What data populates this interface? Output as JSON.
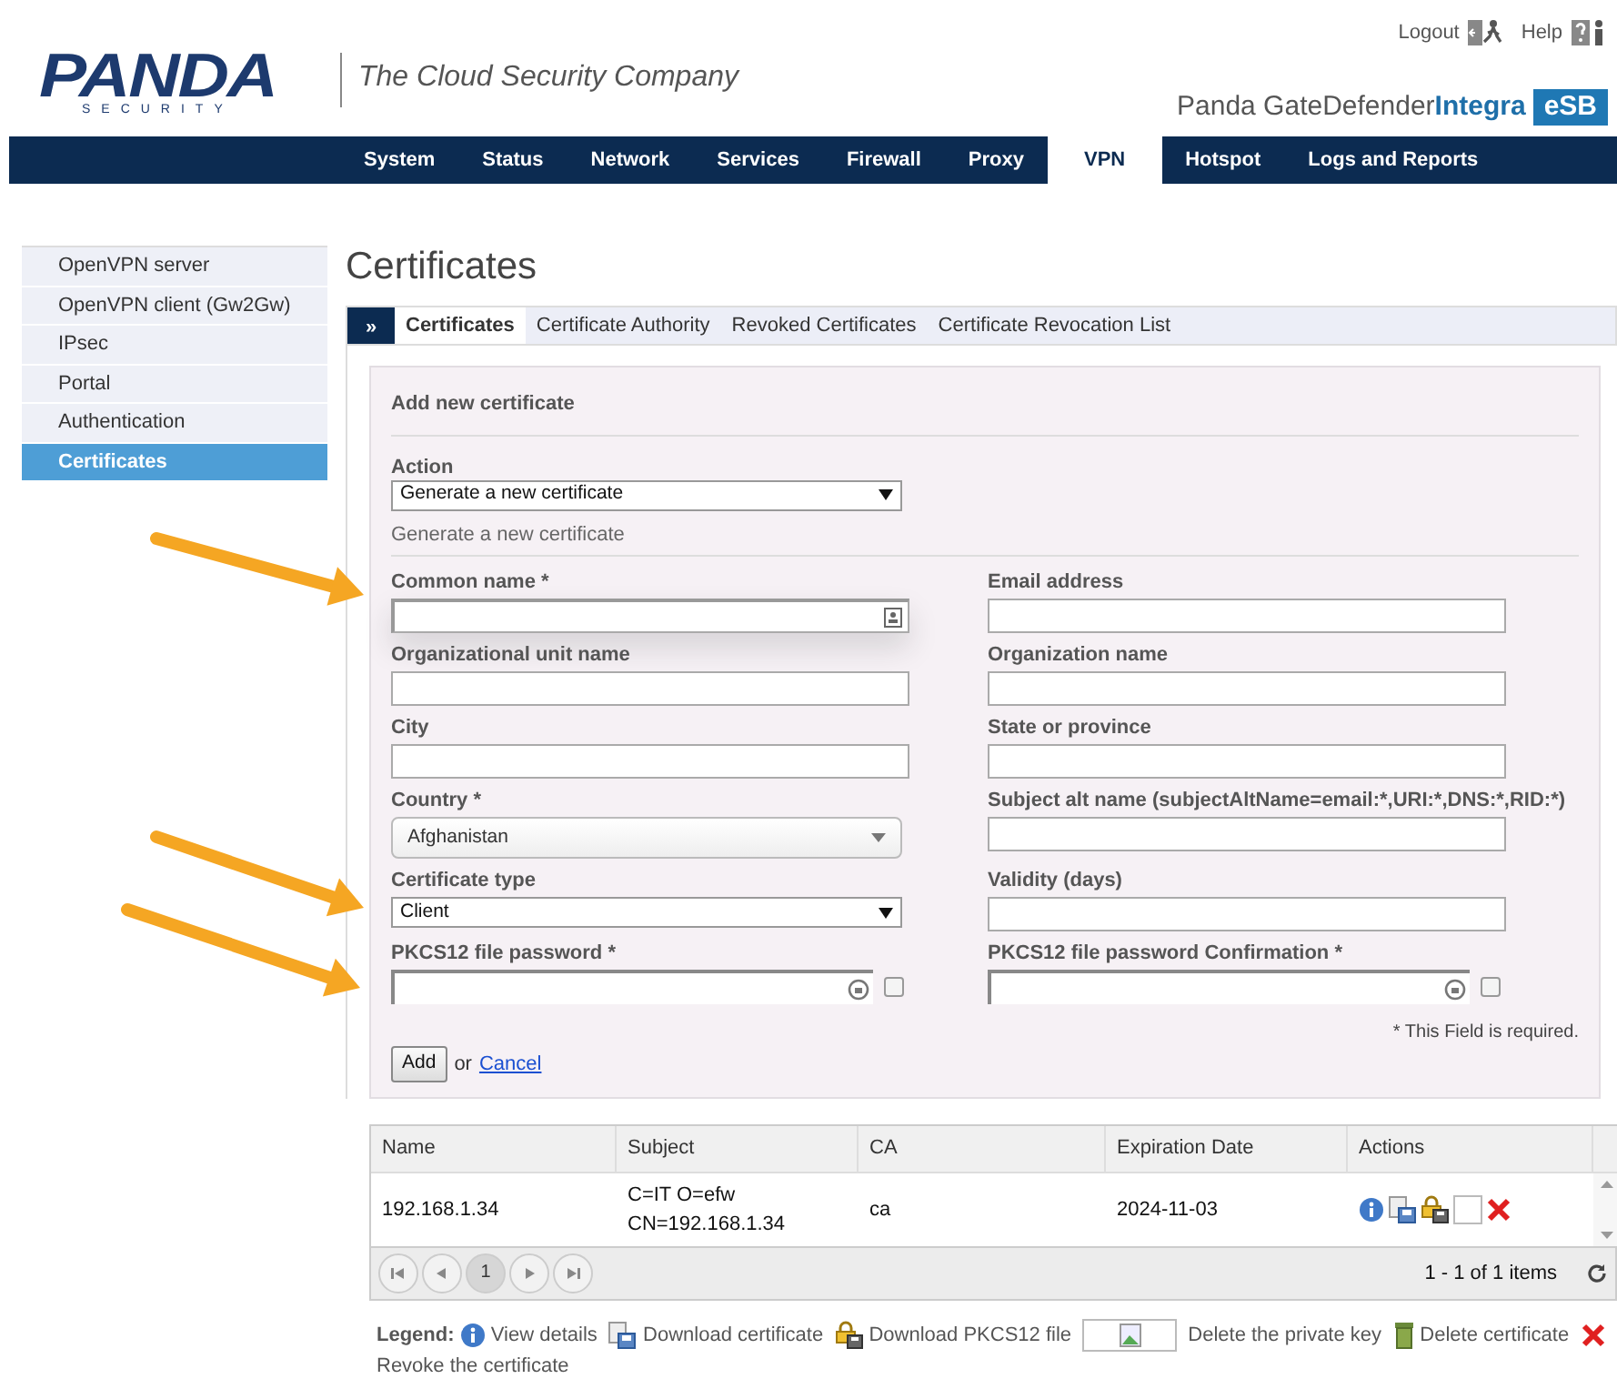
{
  "header": {
    "logo_name": "PANDA",
    "logo_sub": "SECURITY",
    "tagline": "The Cloud Security Company",
    "links": [
      {
        "label": "Logout",
        "kind": "logout"
      },
      {
        "label": "Help",
        "kind": "help"
      }
    ],
    "product": "Panda GateDefender**Integra**",
    "product_badge": "eSB"
  },
  "nav": [
    {
      "label": "System",
      "selected": false
    },
    {
      "label": "Status",
      "selected": false
    },
    {
      "label": "Network",
      "selected": false
    },
    {
      "label": "Services",
      "selected": false
    },
    {
      "label": "Firewall",
      "selected": false
    },
    {
      "label": "Proxy",
      "selected": false
    },
    {
      "label": "VPN",
      "selected": true
    },
    {
      "label": "Hotspot",
      "selected": false
    },
    {
      "label": "Logs and Reports",
      "selected": false
    }
  ],
  "sidebar": [
    {
      "label": "OpenVPN server",
      "selected": false
    },
    {
      "label": "OpenVPN client (Gw2Gw)",
      "selected": false
    },
    {
      "label": "IPsec",
      "selected": false
    },
    {
      "label": "Portal",
      "selected": false
    },
    {
      "label": "Authentication",
      "selected": false
    },
    {
      "label": "Certificates",
      "selected": true
    }
  ],
  "page_title": "Certificates",
  "tab_toggle": "»",
  "tabs": [
    {
      "label": "Certificates",
      "selected": true
    },
    {
      "label": "Certificate Authority",
      "selected": false
    },
    {
      "label": "Revoked Certificates",
      "selected": false
    },
    {
      "label": "Certificate Revocation List",
      "selected": false
    }
  ],
  "form": {
    "title": "Add new certificate",
    "action": {
      "label": "Action",
      "value": "Generate a new certificate"
    },
    "subtitle": "Generate a new certificate",
    "fields": [
      {
        "label": "Common name *",
        "kind": "text-icon"
      },
      {
        "label": "Email address",
        "kind": "text"
      },
      {
        "label": "Organizational unit name",
        "kind": "text"
      },
      {
        "label": "Organization name",
        "kind": "text"
      },
      {
        "label": "City",
        "kind": "text"
      },
      {
        "label": "State or province",
        "kind": "text"
      },
      {
        "label": "Country *",
        "kind": "select-rounded",
        "value": "Afghanistan"
      },
      {
        "label": "Subject alt name (subjectAltName=email:*,URI:*,DNS:*,RID:*)",
        "kind": "text"
      },
      {
        "label": "Certificate type",
        "kind": "select",
        "value": "Client"
      },
      {
        "label": "Validity (days)",
        "kind": "text"
      },
      {
        "label": "PKCS12 file password *",
        "kind": "password",
        "checked": false
      },
      {
        "label": "PKCS12 file password Confirmation *",
        "kind": "password",
        "checked": false
      }
    ],
    "required_note": "* This Field is required.",
    "add_button": "Add",
    "or_text": "or",
    "cancel_link": "Cancel"
  },
  "table": {
    "columns": [
      "Name",
      "Subject",
      "CA",
      "Expiration Date",
      "Actions"
    ],
    "rows": [
      {
        "name": "192.168.1.34",
        "subject": [
          "C=IT O=efw",
          "CN=192.168.1.34"
        ],
        "ca": "ca",
        "expiration": "2024-11-03",
        "actions": [
          {
            "kind": "info"
          },
          {
            "kind": "download-cert"
          },
          {
            "kind": "download-pkcs12"
          },
          {
            "kind": "blank"
          },
          {
            "kind": "revoke"
          }
        ]
      }
    ],
    "pager": {
      "pages": [
        {
          "label": "1",
          "selected": true
        }
      ],
      "summary": "1 - 1 of 1 items"
    }
  },
  "legend": {
    "label": "Legend:",
    "items": [
      {
        "kind": "info",
        "text": "View details"
      },
      {
        "kind": "download-cert",
        "text": "Download certificate"
      },
      {
        "kind": "download-pkcs12",
        "text": "Download PKCS12 file"
      },
      {
        "kind": "broken-image",
        "text": "Delete the private key"
      },
      {
        "kind": "trash",
        "text": "Delete certificate"
      },
      {
        "kind": "revoke",
        "text": "Revoke the certificate"
      }
    ]
  }
}
